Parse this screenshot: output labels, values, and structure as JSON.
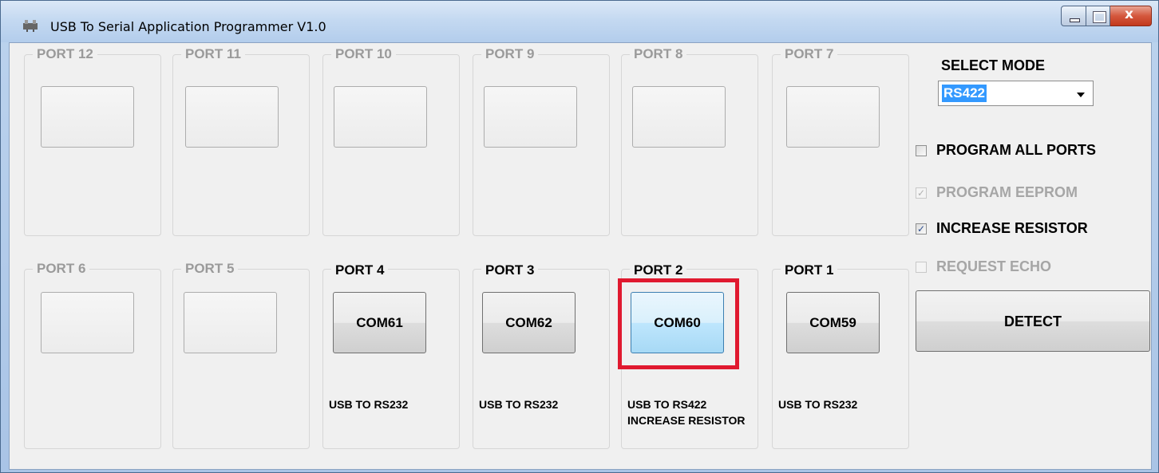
{
  "window": {
    "title": "USB To Serial Application Programmer V1.0"
  },
  "ports_top": [
    {
      "title": "PORT 12",
      "button": "",
      "desc1": "",
      "desc2": ""
    },
    {
      "title": "PORT 11",
      "button": "",
      "desc1": "",
      "desc2": ""
    },
    {
      "title": "PORT 10",
      "button": "",
      "desc1": "",
      "desc2": ""
    },
    {
      "title": "PORT 9",
      "button": "",
      "desc1": "",
      "desc2": ""
    },
    {
      "title": "PORT 8",
      "button": "",
      "desc1": "",
      "desc2": ""
    },
    {
      "title": "PORT 7",
      "button": "",
      "desc1": "",
      "desc2": ""
    }
  ],
  "ports_bottom": [
    {
      "title": "PORT 6",
      "button": "",
      "desc1": "",
      "desc2": ""
    },
    {
      "title": "PORT 5",
      "button": "",
      "desc1": "",
      "desc2": ""
    },
    {
      "title": "PORT 4",
      "button": "COM61",
      "desc1": "USB TO RS232",
      "desc2": ""
    },
    {
      "title": "PORT 3",
      "button": "COM62",
      "desc1": "USB TO RS232",
      "desc2": ""
    },
    {
      "title": "PORT 2",
      "button": "COM60",
      "desc1": "USB TO RS422",
      "desc2": "INCREASE RESISTOR"
    },
    {
      "title": "PORT 1",
      "button": "COM59",
      "desc1": "USB TO RS232",
      "desc2": ""
    }
  ],
  "mode": {
    "label": "SELECT MODE",
    "value": "RS422"
  },
  "options": {
    "program_all_ports": {
      "label": "PROGRAM ALL PORTS",
      "checked": false,
      "enabled": true
    },
    "program_eeprom": {
      "label": "PROGRAM EEPROM",
      "checked": true,
      "enabled": false
    },
    "increase_resistor": {
      "label": "INCREASE RESISTOR",
      "checked": true,
      "enabled": true
    },
    "request_echo": {
      "label": "REQUEST ECHO",
      "checked": false,
      "enabled": false
    }
  },
  "detect_label": "DETECT",
  "colors": {
    "highlight": "#e0192f",
    "selected_button": "#bee6fd"
  }
}
